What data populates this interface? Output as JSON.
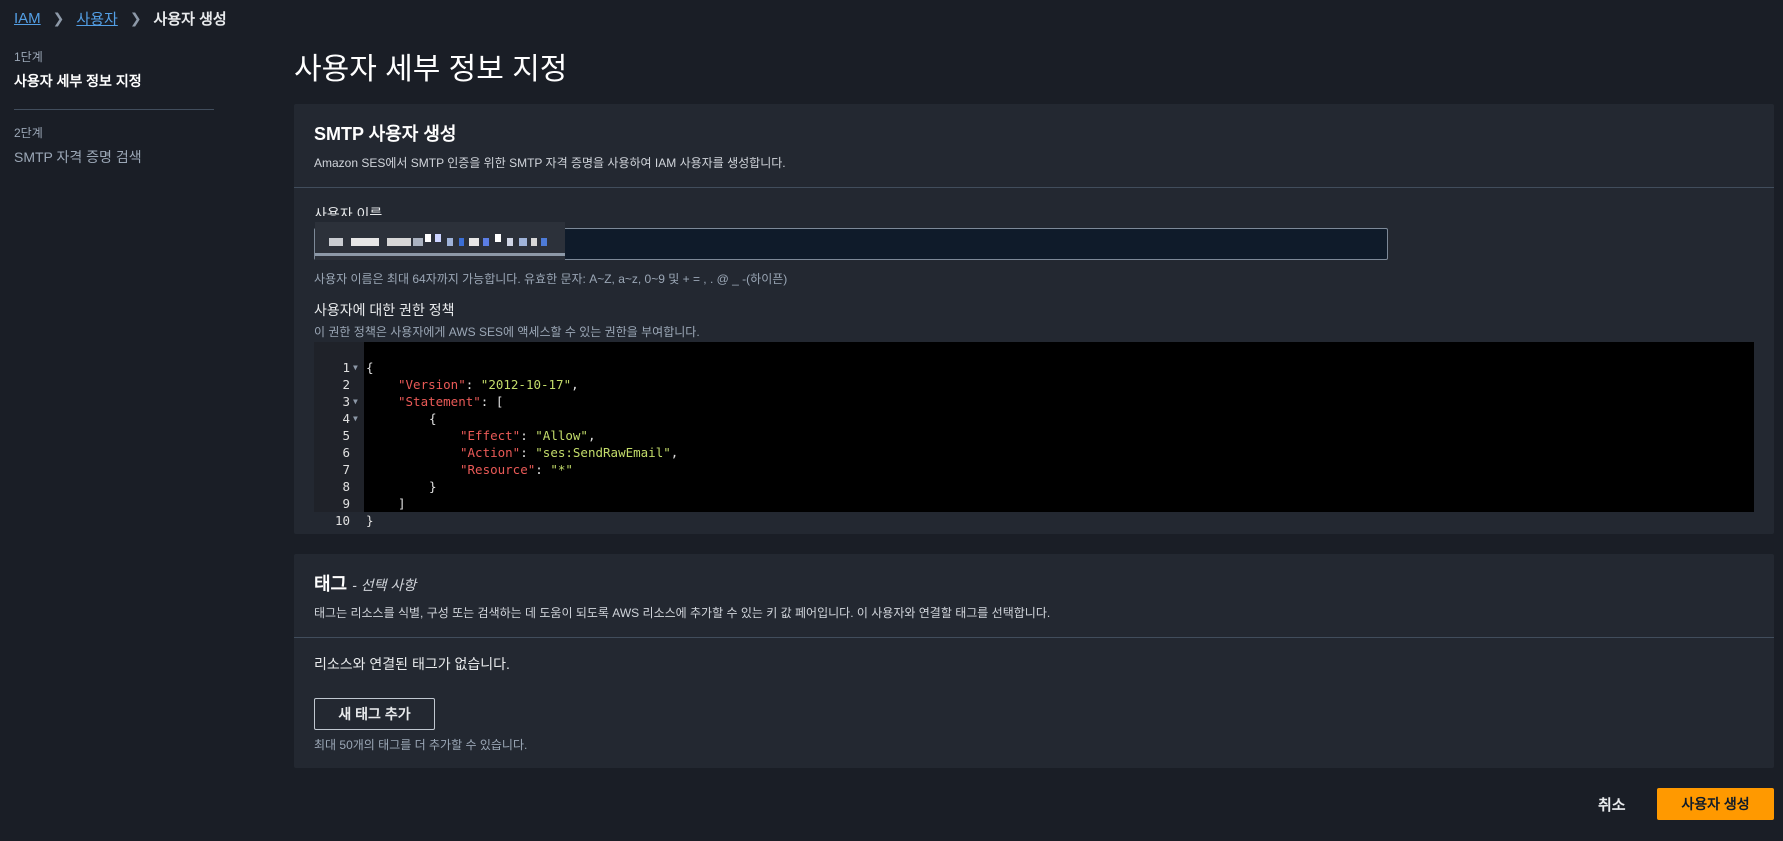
{
  "breadcrumb": {
    "item1": "IAM",
    "item2": "사용자",
    "current": "사용자 생성"
  },
  "steps": [
    {
      "num": "1단계",
      "title": "사용자 세부 정보 지정"
    },
    {
      "num": "2단계",
      "title": "SMTP 자격 증명 검색"
    }
  ],
  "page_title": "사용자 세부 정보 지정",
  "smtp_panel": {
    "title": "SMTP 사용자 생성",
    "description": "Amazon SES에서 SMTP 인증을 위한 SMTP 자격 증명을 사용하여 IAM 사용자를 생성합니다.",
    "username_label": "사용자 이름",
    "username_hint": "사용자 이름은 최대 64자까지 가능합니다. 유효한 문자: A~Z, a~z, 0~9 및 + = , . @ _ -(하이픈)",
    "policy_label": "사용자에 대한 권한 정책",
    "policy_hint": "이 권한 정책은 사용자에게 AWS SES에 액세스할 수 있는 권한을 부여합니다."
  },
  "code": {
    "line_numbers": [
      "1",
      "2",
      "3",
      "4",
      "5",
      "6",
      "7",
      "8",
      "9",
      "10"
    ],
    "open_brace": "{",
    "close_brace": "}",
    "version_key": "\"Version\"",
    "version_val": "\"2012-10-17\"",
    "statement_key": "\"Statement\"",
    "effect_key": "\"Effect\"",
    "effect_val": "\"Allow\"",
    "action_key": "\"Action\"",
    "action_val": "\"ses:SendRawEmail\"",
    "resource_key": "\"Resource\"",
    "resource_val": "\"*\""
  },
  "tags_panel": {
    "title": "태그",
    "optional": "- 선택 사항",
    "description": "태그는 리소스를 식별, 구성 또는 검색하는 데 도움이 되도록 AWS 리소스에 추가할 수 있는 키 값 페어입니다. 이 사용자와 연결할 태그를 선택합니다.",
    "empty_text": "리소스와 연결된 태그가 없습니다.",
    "add_button": "새 태그 추가",
    "limit_hint": "최대 50개의 태그를 더 추가할 수 있습니다."
  },
  "footer": {
    "cancel": "취소",
    "create": "사용자 생성"
  },
  "colors": {
    "accent": "#ff9900",
    "link": "#539fe5",
    "background": "#1a1e26",
    "panel": "#232831"
  }
}
